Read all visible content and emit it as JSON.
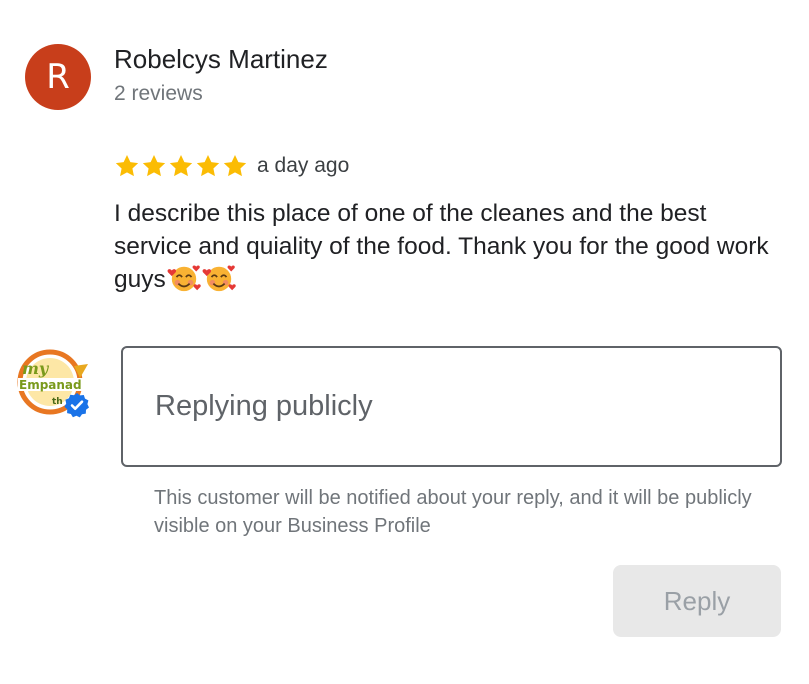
{
  "review": {
    "avatar_letter": "R",
    "avatar_color": "#c83e1b",
    "reviewer_name": "Robelcys Martinez",
    "review_count": "2 reviews",
    "rating": 5,
    "rating_max": 5,
    "star_color": "#fbbc04",
    "time_ago": "a day ago",
    "text": "I describe this place of one of the cleanes and the best service and quiality of the food. Thank you for the good work guys",
    "trailing_emojis": [
      "smiling-face-with-hearts",
      "smiling-face-with-hearts"
    ]
  },
  "reply": {
    "owner_logo_text_top": "my",
    "owner_logo_text_mid": "Empanad",
    "owner_logo_text_bottom": "th",
    "verified_badge_color": "#1a73e8",
    "placeholder": "Replying publicly",
    "notice": "This customer will be notified about your reply, and it will be publicly visible on your Business Profile",
    "button_label": "Reply"
  }
}
